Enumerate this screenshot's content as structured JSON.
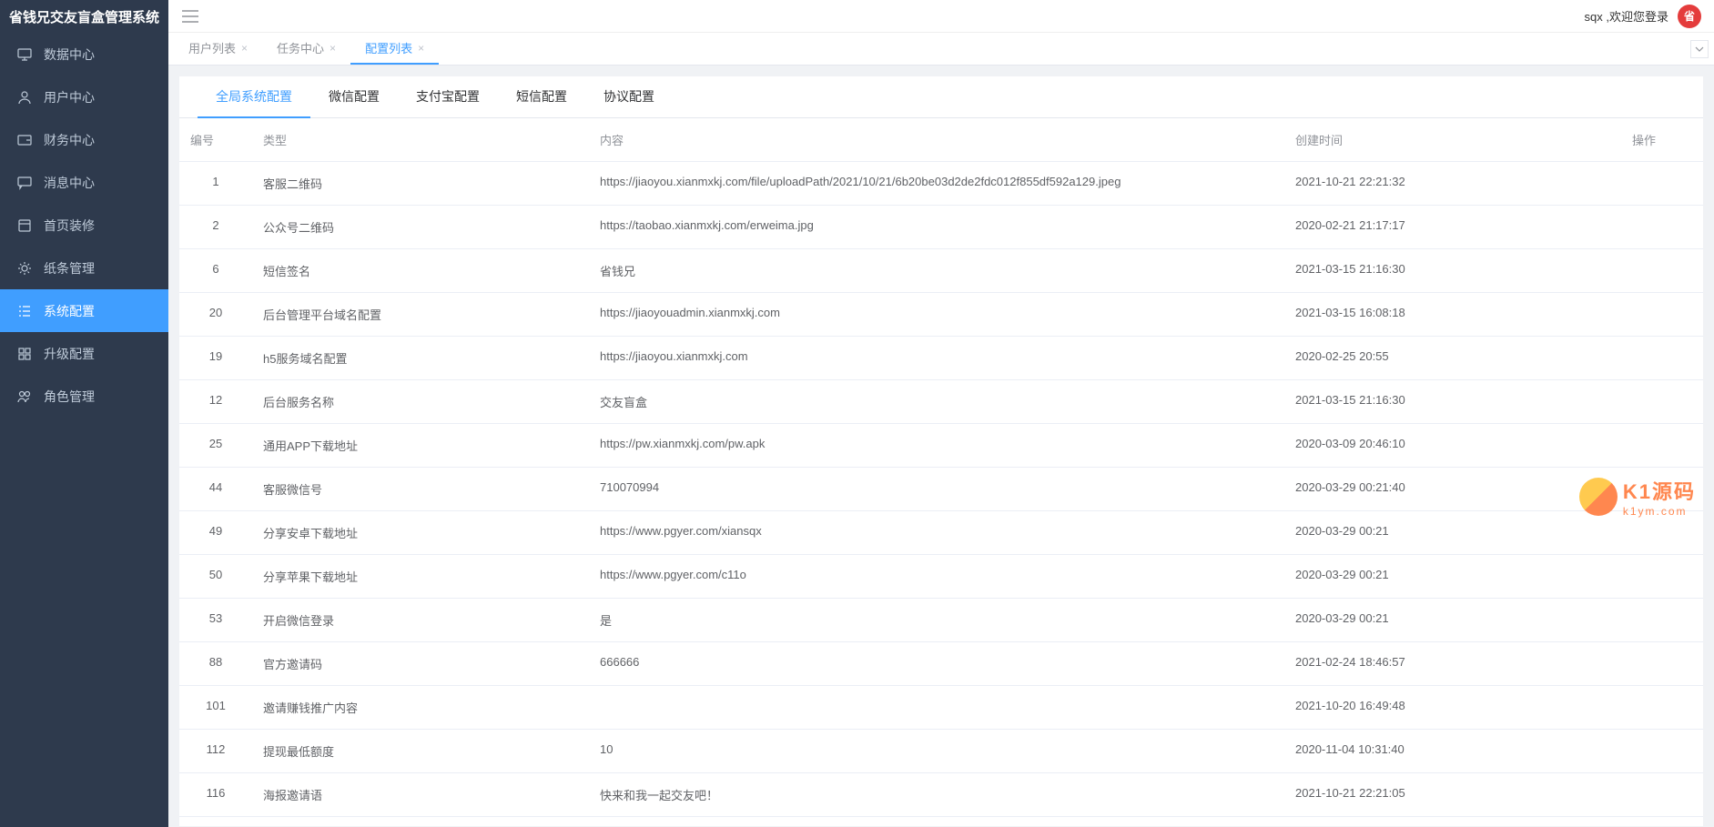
{
  "app_title": "省钱兄交友盲盒管理系统",
  "user_greeting": "sqx ,欢迎您登录",
  "avatar_text": "省",
  "sidebar": {
    "items": [
      {
        "label": "数据中心",
        "icon": "monitor"
      },
      {
        "label": "用户中心",
        "icon": "user"
      },
      {
        "label": "财务中心",
        "icon": "wallet"
      },
      {
        "label": "消息中心",
        "icon": "chat"
      },
      {
        "label": "首页装修",
        "icon": "box"
      },
      {
        "label": "纸条管理",
        "icon": "gear"
      },
      {
        "label": "系统配置",
        "icon": "list",
        "active": true
      },
      {
        "label": "升级配置",
        "icon": "grid"
      },
      {
        "label": "角色管理",
        "icon": "people"
      }
    ]
  },
  "tabs": [
    {
      "label": "用户列表",
      "active": false
    },
    {
      "label": "任务中心",
      "active": false
    },
    {
      "label": "配置列表",
      "active": true
    }
  ],
  "sub_tabs": [
    {
      "label": "全局系统配置",
      "active": true
    },
    {
      "label": "微信配置",
      "active": false
    },
    {
      "label": "支付宝配置",
      "active": false
    },
    {
      "label": "短信配置",
      "active": false
    },
    {
      "label": "协议配置",
      "active": false
    }
  ],
  "table": {
    "headers": {
      "id": "编号",
      "type": "类型",
      "content": "内容",
      "time": "创建时间",
      "op": "操作"
    },
    "rows": [
      {
        "id": "1",
        "type": "客服二维码",
        "content": "https://jiaoyou.xianmxkj.com/file/uploadPath/2021/10/21/6b20be03d2de2fdc012f855df592a129.jpeg",
        "time": "2021-10-21 22:21:32"
      },
      {
        "id": "2",
        "type": "公众号二维码",
        "content": "https://taobao.xianmxkj.com/erweima.jpg",
        "time": "2020-02-21 21:17:17"
      },
      {
        "id": "6",
        "type": "短信签名",
        "content": "省钱兄",
        "time": "2021-03-15 21:16:30"
      },
      {
        "id": "20",
        "type": "后台管理平台域名配置",
        "content": "https://jiaoyouadmin.xianmxkj.com",
        "time": "2021-03-15 16:08:18"
      },
      {
        "id": "19",
        "type": "h5服务域名配置",
        "content": "https://jiaoyou.xianmxkj.com",
        "time": "2020-02-25 20:55"
      },
      {
        "id": "12",
        "type": "后台服务名称",
        "content": "交友盲盒",
        "time": "2021-03-15 21:16:30"
      },
      {
        "id": "25",
        "type": "通用APP下载地址",
        "content": "https://pw.xianmxkj.com/pw.apk",
        "time": "2020-03-09 20:46:10"
      },
      {
        "id": "44",
        "type": "客服微信号",
        "content": "710070994",
        "time": "2020-03-29 00:21:40"
      },
      {
        "id": "49",
        "type": "分享安卓下载地址",
        "content": "https://www.pgyer.com/xiansqx",
        "time": "2020-03-29 00:21"
      },
      {
        "id": "50",
        "type": "分享苹果下载地址",
        "content": "https://www.pgyer.com/c11o",
        "time": "2020-03-29 00:21"
      },
      {
        "id": "53",
        "type": "开启微信登录",
        "content": "是",
        "time": "2020-03-29 00:21"
      },
      {
        "id": "88",
        "type": "官方邀请码",
        "content": "666666",
        "time": "2021-02-24 18:46:57"
      },
      {
        "id": "101",
        "type": "邀请赚钱推广内容",
        "content": "",
        "time": "2021-10-20 16:49:48"
      },
      {
        "id": "112",
        "type": "提现最低额度",
        "content": "10",
        "time": "2020-11-04 10:31:40"
      },
      {
        "id": "116",
        "type": "海报邀请语",
        "content": "快来和我一起交友吧！",
        "time": "2021-10-21 22:21:05"
      }
    ]
  },
  "watermark": {
    "brand": "K1源码",
    "url": "k1ym.com"
  }
}
